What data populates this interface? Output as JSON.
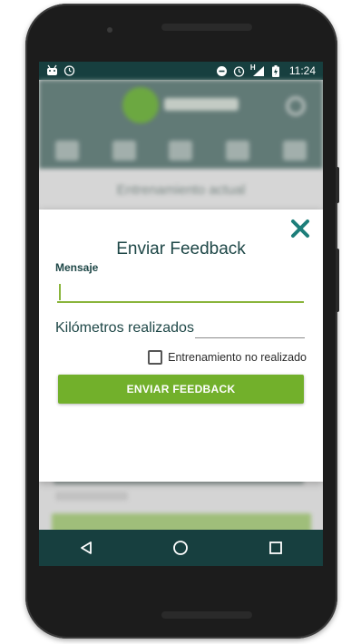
{
  "status_bar": {
    "time": "11:24",
    "network_label": "H",
    "left_icons": [
      "android-icon",
      "alarm-icon"
    ],
    "right_icons": [
      "dnd-icon",
      "alarm-icon",
      "signal-icon",
      "battery-icon"
    ]
  },
  "background_app": {
    "section_title": "Entrenamiento actual"
  },
  "dialog": {
    "title": "Enviar Feedback",
    "message_label": "Mensaje",
    "message_value": "",
    "km_label": "Kilómetros realizados",
    "km_value": "",
    "checkbox_label": "Entrenamiento no realizado",
    "checkbox_checked": false,
    "send_button_label": "ENVIAR FEEDBACK",
    "close_icon": "close-icon"
  },
  "nav_bar": {
    "buttons": [
      "back-icon",
      "home-icon",
      "recents-icon"
    ]
  },
  "colors": {
    "primary_dark": "#173f3f",
    "accent_green": "#72b02b",
    "close_teal": "#1d7e7a",
    "title_text": "#1e4747"
  }
}
